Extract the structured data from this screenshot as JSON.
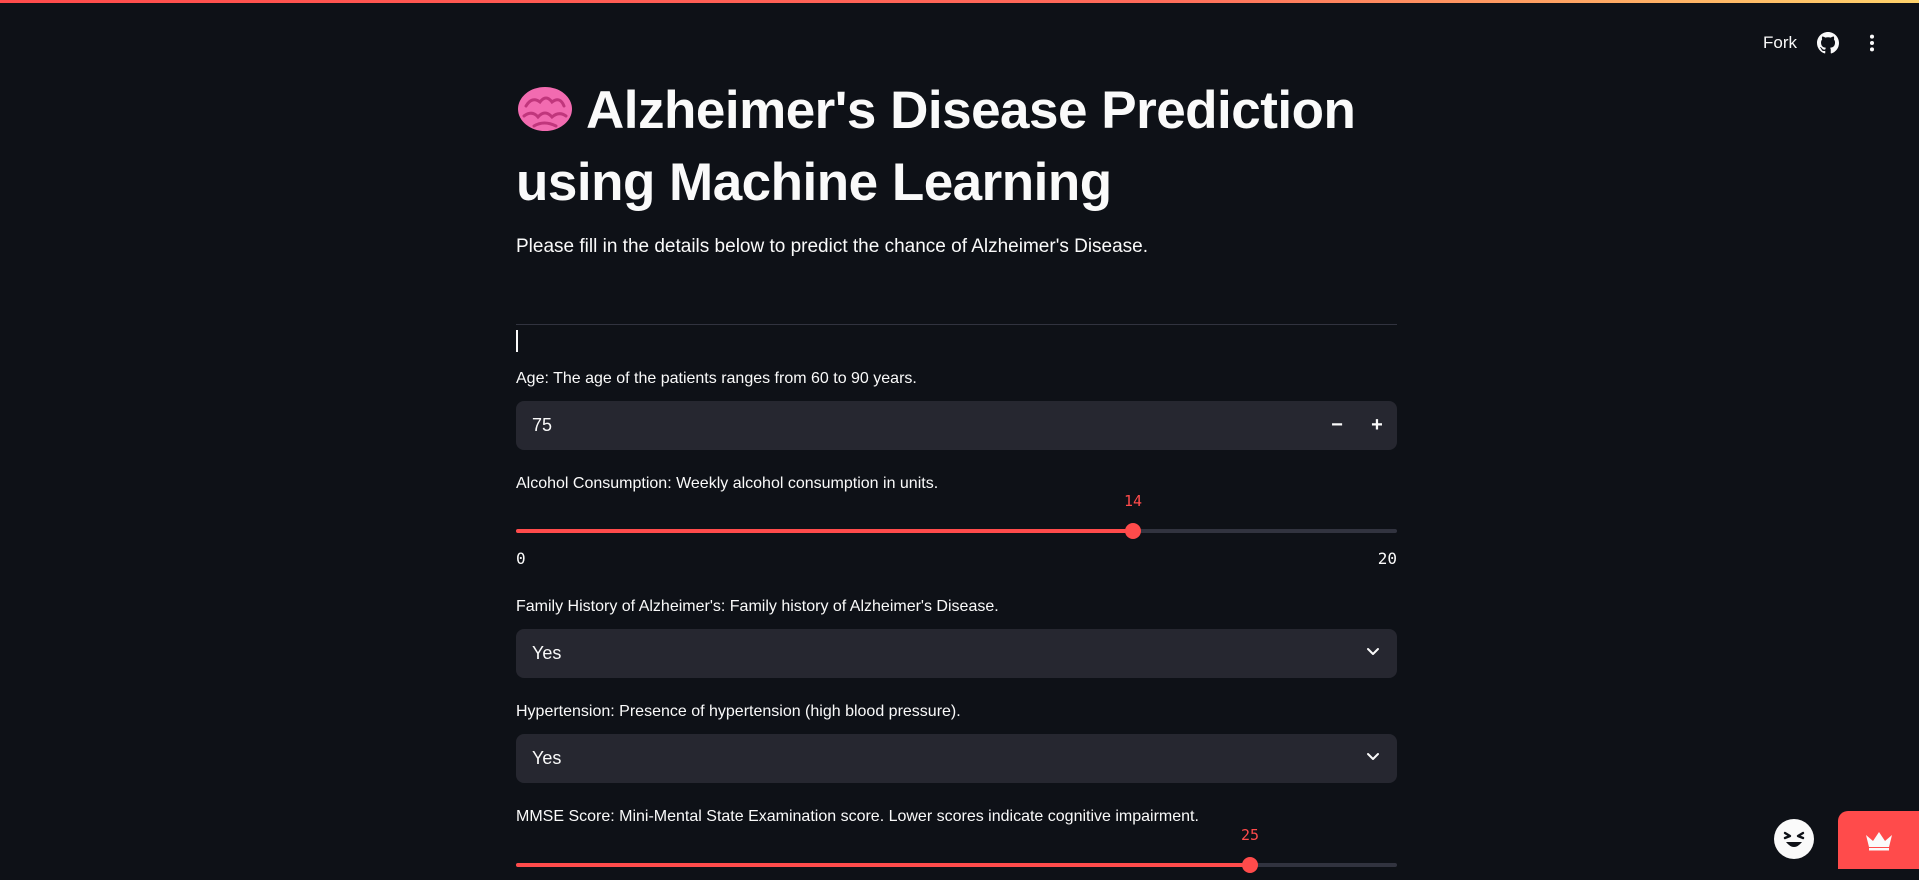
{
  "toolbar": {
    "fork_label": "Fork",
    "github_icon": "github-icon",
    "menu_icon": "more-vertical-icon"
  },
  "header": {
    "title": "Alzheimer's Disease Prediction using Machine Learning",
    "title_icon": "brain-icon",
    "subtitle": "Please fill in the details below to predict the chance of Alzheimer's Disease."
  },
  "form": {
    "age": {
      "label": "Age: The age of the patients ranges from 60 to 90 years.",
      "value": "75",
      "minus_label": "−",
      "plus_label": "+"
    },
    "alcohol": {
      "label": "Alcohol Consumption: Weekly alcohol consumption in units.",
      "value": 14,
      "min": 0,
      "max": 20,
      "value_label": "14",
      "min_label": "0",
      "max_label": "20"
    },
    "family_history": {
      "label": "Family History of Alzheimer's: Family history of Alzheimer's Disease.",
      "selected": "Yes"
    },
    "hypertension": {
      "label": "Hypertension: Presence of hypertension (high blood pressure).",
      "selected": "Yes"
    },
    "mmse": {
      "label": "MMSE Score: Mini-Mental State Examination score. Lower scores indicate cognitive impairment.",
      "value": 25,
      "min": 0,
      "max": 30,
      "value_label": "25"
    }
  },
  "colors": {
    "background": "#0e1117",
    "accent": "#ff4b4b",
    "input_bg": "#262730",
    "text": "#fafafa"
  },
  "floating": {
    "face_icon": "grinning-face-icon",
    "crown_icon": "crown-icon"
  }
}
